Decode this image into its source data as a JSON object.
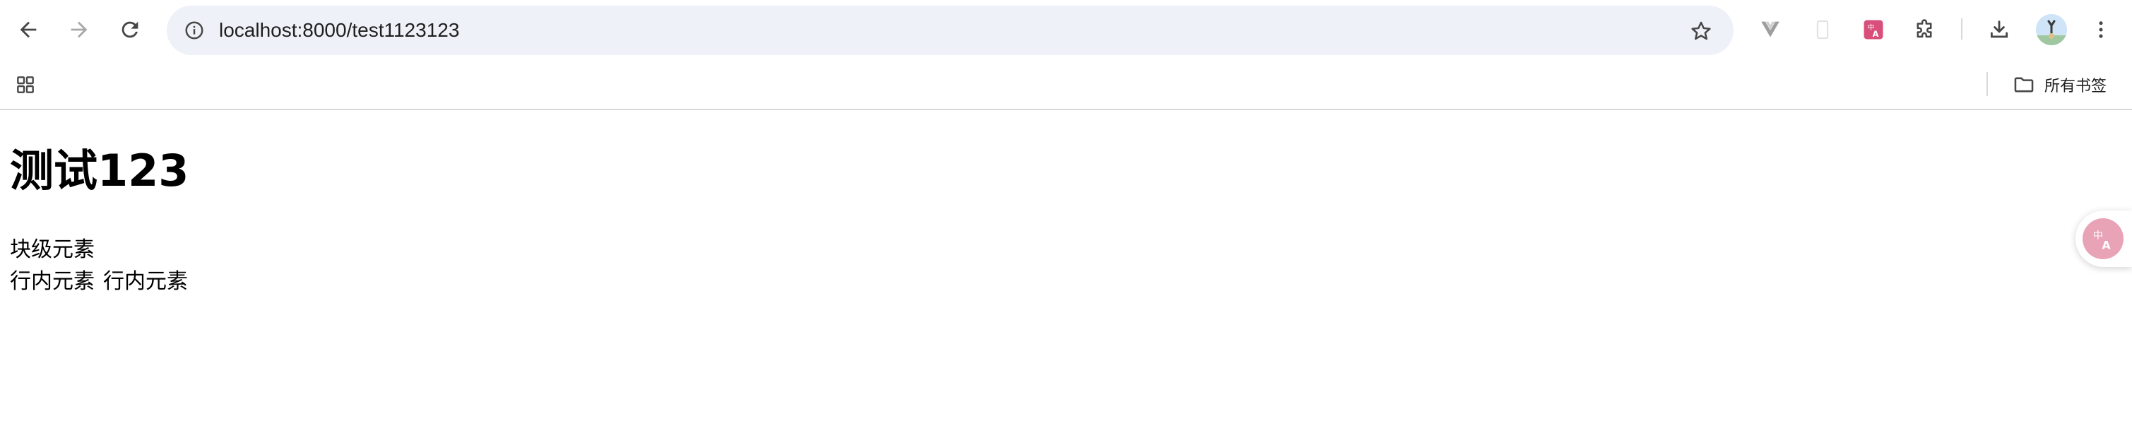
{
  "browser": {
    "url": "localhost:8000/test1123123",
    "bookmarks_label": "所有书签"
  },
  "page": {
    "heading": "测试123",
    "block_element_text": "块级元素",
    "inline_elements": [
      "行内元素",
      "行内元素"
    ]
  },
  "icons": {
    "back": "arrow-left-icon",
    "forward": "arrow-right-icon",
    "reload": "reload-icon",
    "site_info": "info-icon",
    "bookmark_star": "star-icon",
    "vue_devtools": "vue-icon",
    "empty_extension": "extension-placeholder-icon",
    "translate_extension": "translate-icon",
    "extensions": "puzzle-icon",
    "downloads": "download-icon",
    "menu": "more-vertical-icon",
    "apps": "apps-grid-icon",
    "bookmarks_folder": "folder-icon"
  },
  "colors": {
    "omnibox_bg": "#eef2f8",
    "translate_accent": "#d94f7b",
    "translate_float": "#e8a3b6"
  }
}
